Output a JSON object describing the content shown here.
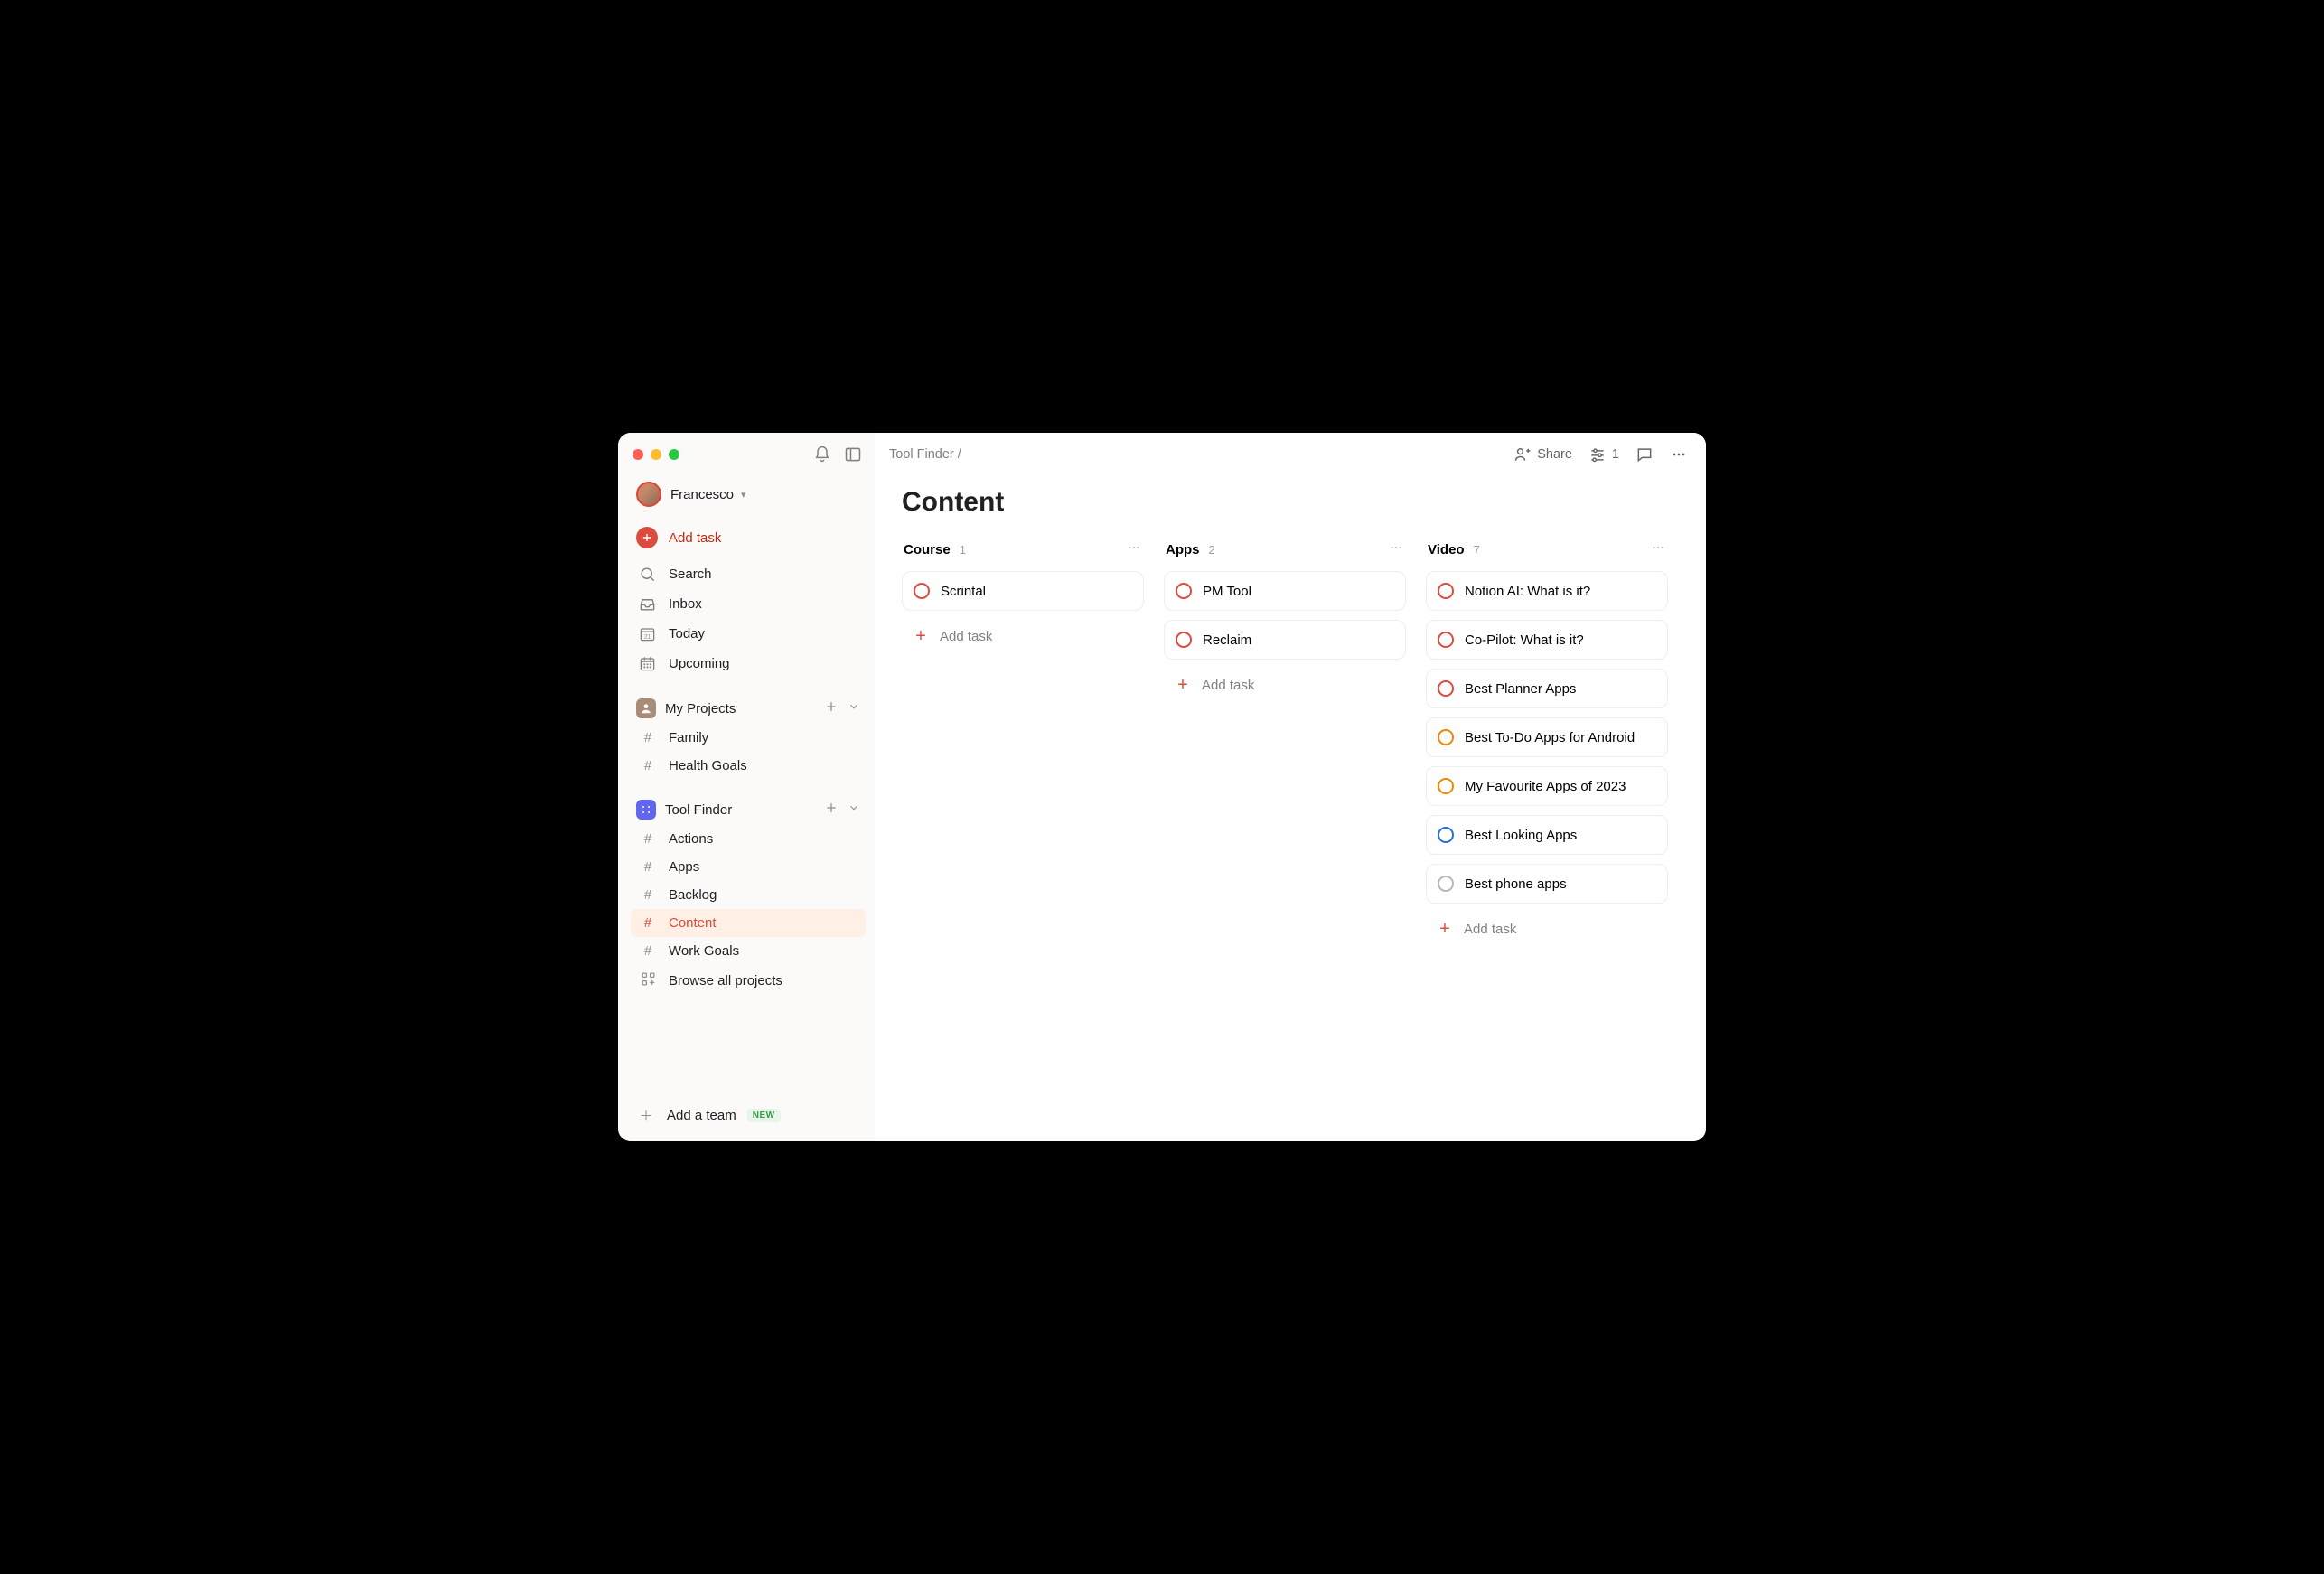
{
  "workspace": {
    "name": "Francesco"
  },
  "sidebar": {
    "add_task": "Add task",
    "nav": [
      {
        "label": "Search"
      },
      {
        "label": "Inbox"
      },
      {
        "label": "Today"
      },
      {
        "label": "Upcoming"
      }
    ],
    "sections": [
      {
        "title": "My Projects",
        "icon_bg": "#a88c78",
        "items": [
          {
            "label": "Family"
          },
          {
            "label": "Health Goals"
          }
        ]
      },
      {
        "title": "Tool Finder",
        "icon_bg": "#6166f0",
        "items": [
          {
            "label": "Actions"
          },
          {
            "label": "Apps"
          },
          {
            "label": "Backlog"
          },
          {
            "label": "Content",
            "active": true
          },
          {
            "label": "Work Goals"
          }
        ],
        "browse": "Browse all projects"
      }
    ],
    "footer": {
      "label": "Add a team",
      "badge": "NEW"
    }
  },
  "topbar": {
    "breadcrumb": "Tool Finder /",
    "share": "Share",
    "filter_count": "1"
  },
  "page": {
    "title": "Content"
  },
  "board": {
    "add_task_label": "Add task",
    "columns": [
      {
        "name": "Course",
        "count": "1",
        "cards": [
          {
            "title": "Scrintal",
            "priority": "p1"
          }
        ]
      },
      {
        "name": "Apps",
        "count": "2",
        "cards": [
          {
            "title": "PM Tool",
            "priority": "p1"
          },
          {
            "title": "Reclaim",
            "priority": "p1"
          }
        ]
      },
      {
        "name": "Video",
        "count": "7",
        "cards": [
          {
            "title": "Notion AI: What is it?",
            "priority": "p1"
          },
          {
            "title": "Co-Pilot: What is it?",
            "priority": "p1"
          },
          {
            "title": "Best Planner Apps",
            "priority": "p1"
          },
          {
            "title": "Best To-Do Apps for Android",
            "priority": "p2"
          },
          {
            "title": "My Favourite Apps of 2023",
            "priority": "p2"
          },
          {
            "title": "Best Looking Apps",
            "priority": "p3"
          },
          {
            "title": "Best phone apps",
            "priority": "p4"
          }
        ]
      }
    ]
  }
}
